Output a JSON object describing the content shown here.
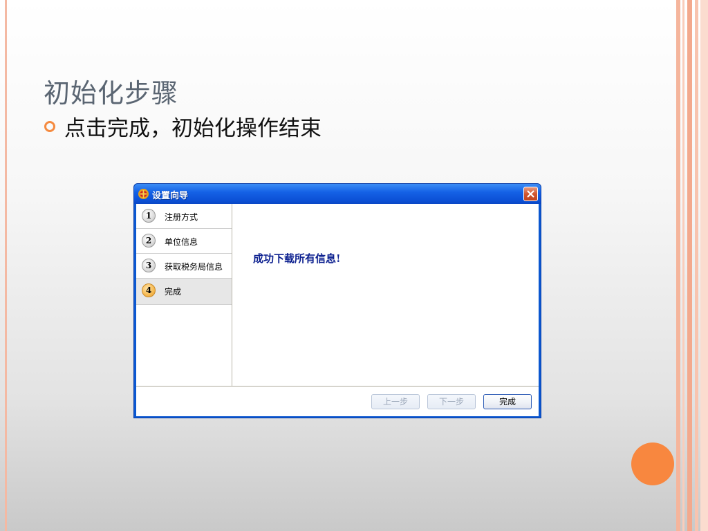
{
  "slide": {
    "title": "初始化步骤",
    "bullet": "点击完成，初始化操作结束"
  },
  "dialog": {
    "title": "设置向导",
    "steps": [
      {
        "num": "1",
        "label": "注册方式"
      },
      {
        "num": "2",
        "label": "单位信息"
      },
      {
        "num": "3",
        "label": "获取税务局信息"
      },
      {
        "num": "4",
        "label": "完成"
      }
    ],
    "active_step": 4,
    "message": "成功下载所有信息!",
    "buttons": {
      "prev": "上一步",
      "next": "下一步",
      "finish": "完成"
    }
  },
  "colors": {
    "accent": "#f8873f",
    "titlebar": "#0b57d0",
    "message": "#0b1f8f"
  }
}
